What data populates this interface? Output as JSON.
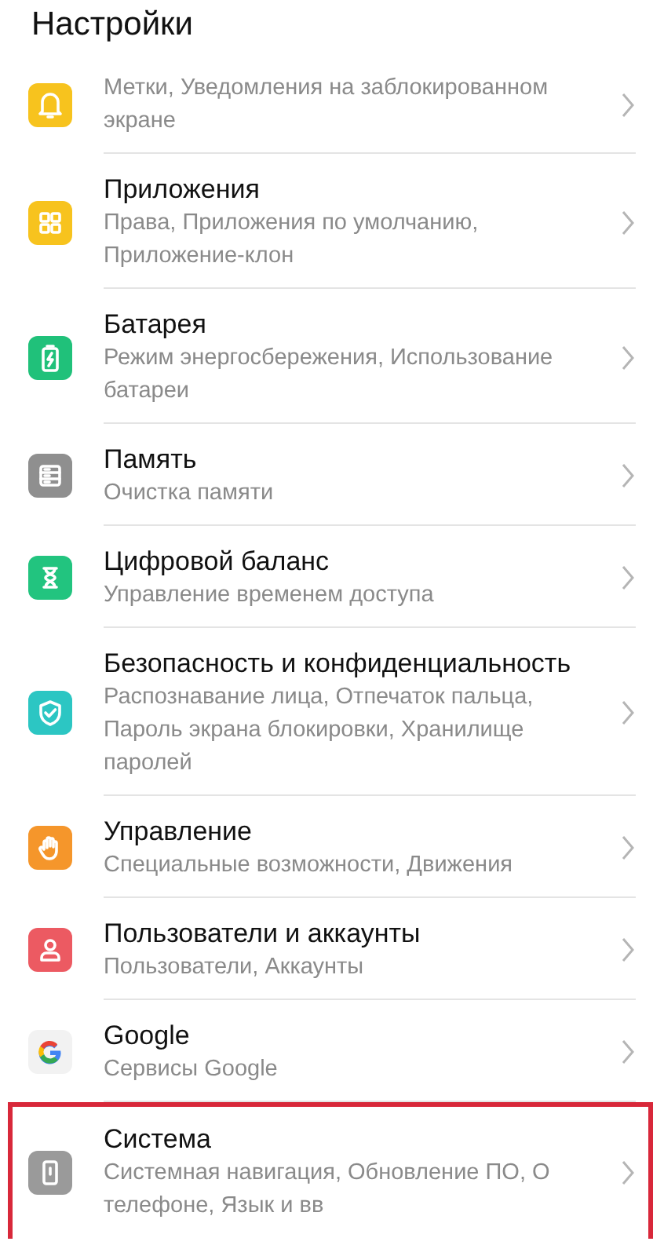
{
  "header": {
    "title": "Настройки"
  },
  "items": [
    {
      "subtitle": "Метки, Уведомления на заблокированном экране",
      "color": "#f7c31e",
      "highlighted": false
    },
    {
      "title": "Приложения",
      "subtitle": "Права, Приложения по умолчанию, Приложение-клон",
      "color": "#f7c31e",
      "highlighted": false
    },
    {
      "title": "Батарея",
      "subtitle": "Режим энергосбережения, Использование батареи",
      "color": "#20c17a",
      "highlighted": false
    },
    {
      "title": "Память",
      "subtitle": "Очистка памяти",
      "color": "#8f8f8f",
      "highlighted": false
    },
    {
      "title": "Цифровой баланс",
      "subtitle": "Управление временем доступа",
      "color": "#22c47f",
      "highlighted": false
    },
    {
      "title": "Безопасность и конфиденциальность",
      "subtitle": "Распознавание лица, Отпечаток пальца, Пароль экрана блокировки, Хранилище паролей",
      "color": "#2cc6c3",
      "highlighted": false
    },
    {
      "title": "Управление",
      "subtitle": "Специальные возможности, Движения",
      "color": "#f5962b",
      "highlighted": false
    },
    {
      "title": "Пользователи и аккаунты",
      "subtitle": "Пользователи, Аккаунты",
      "color": "#ec5a62",
      "highlighted": false
    },
    {
      "title": "Google",
      "subtitle": "Сервисы Google",
      "color": "#f2f2f2",
      "highlighted": false
    },
    {
      "title": "Система",
      "subtitle": "Системная навигация, Обновление ПО, О телефоне, Язык и вв",
      "color": "#9a9a9a",
      "highlighted": true
    }
  ]
}
